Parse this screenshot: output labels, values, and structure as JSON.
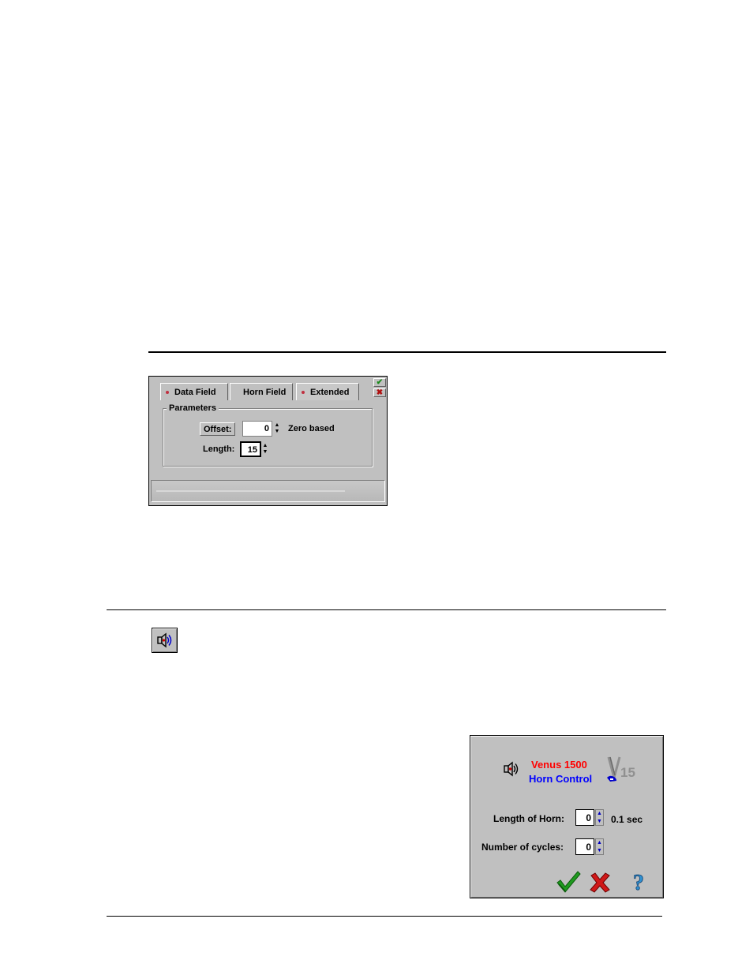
{
  "dialog1": {
    "tabs": [
      {
        "label": "Data Field"
      },
      {
        "label": "Horn Field"
      },
      {
        "label": "Extended"
      }
    ],
    "group_title": "Parameters",
    "offset_label": "Offset:",
    "offset_value": "0",
    "offset_note": "Zero based",
    "length_label": "Length:",
    "length_value": "15"
  },
  "toolbar": {
    "icon": "speaker-icon"
  },
  "dialog2": {
    "title_line1": "Venus 1500",
    "title_line2": "Horn Control",
    "logo_text": "V15",
    "length_label": "Length of Horn:",
    "length_value": "0",
    "length_unit": "0.1 sec",
    "cycles_label": "Number of cycles:",
    "cycles_value": "0",
    "colors": {
      "title1": "#ff0000",
      "title2": "#0000ff"
    }
  }
}
